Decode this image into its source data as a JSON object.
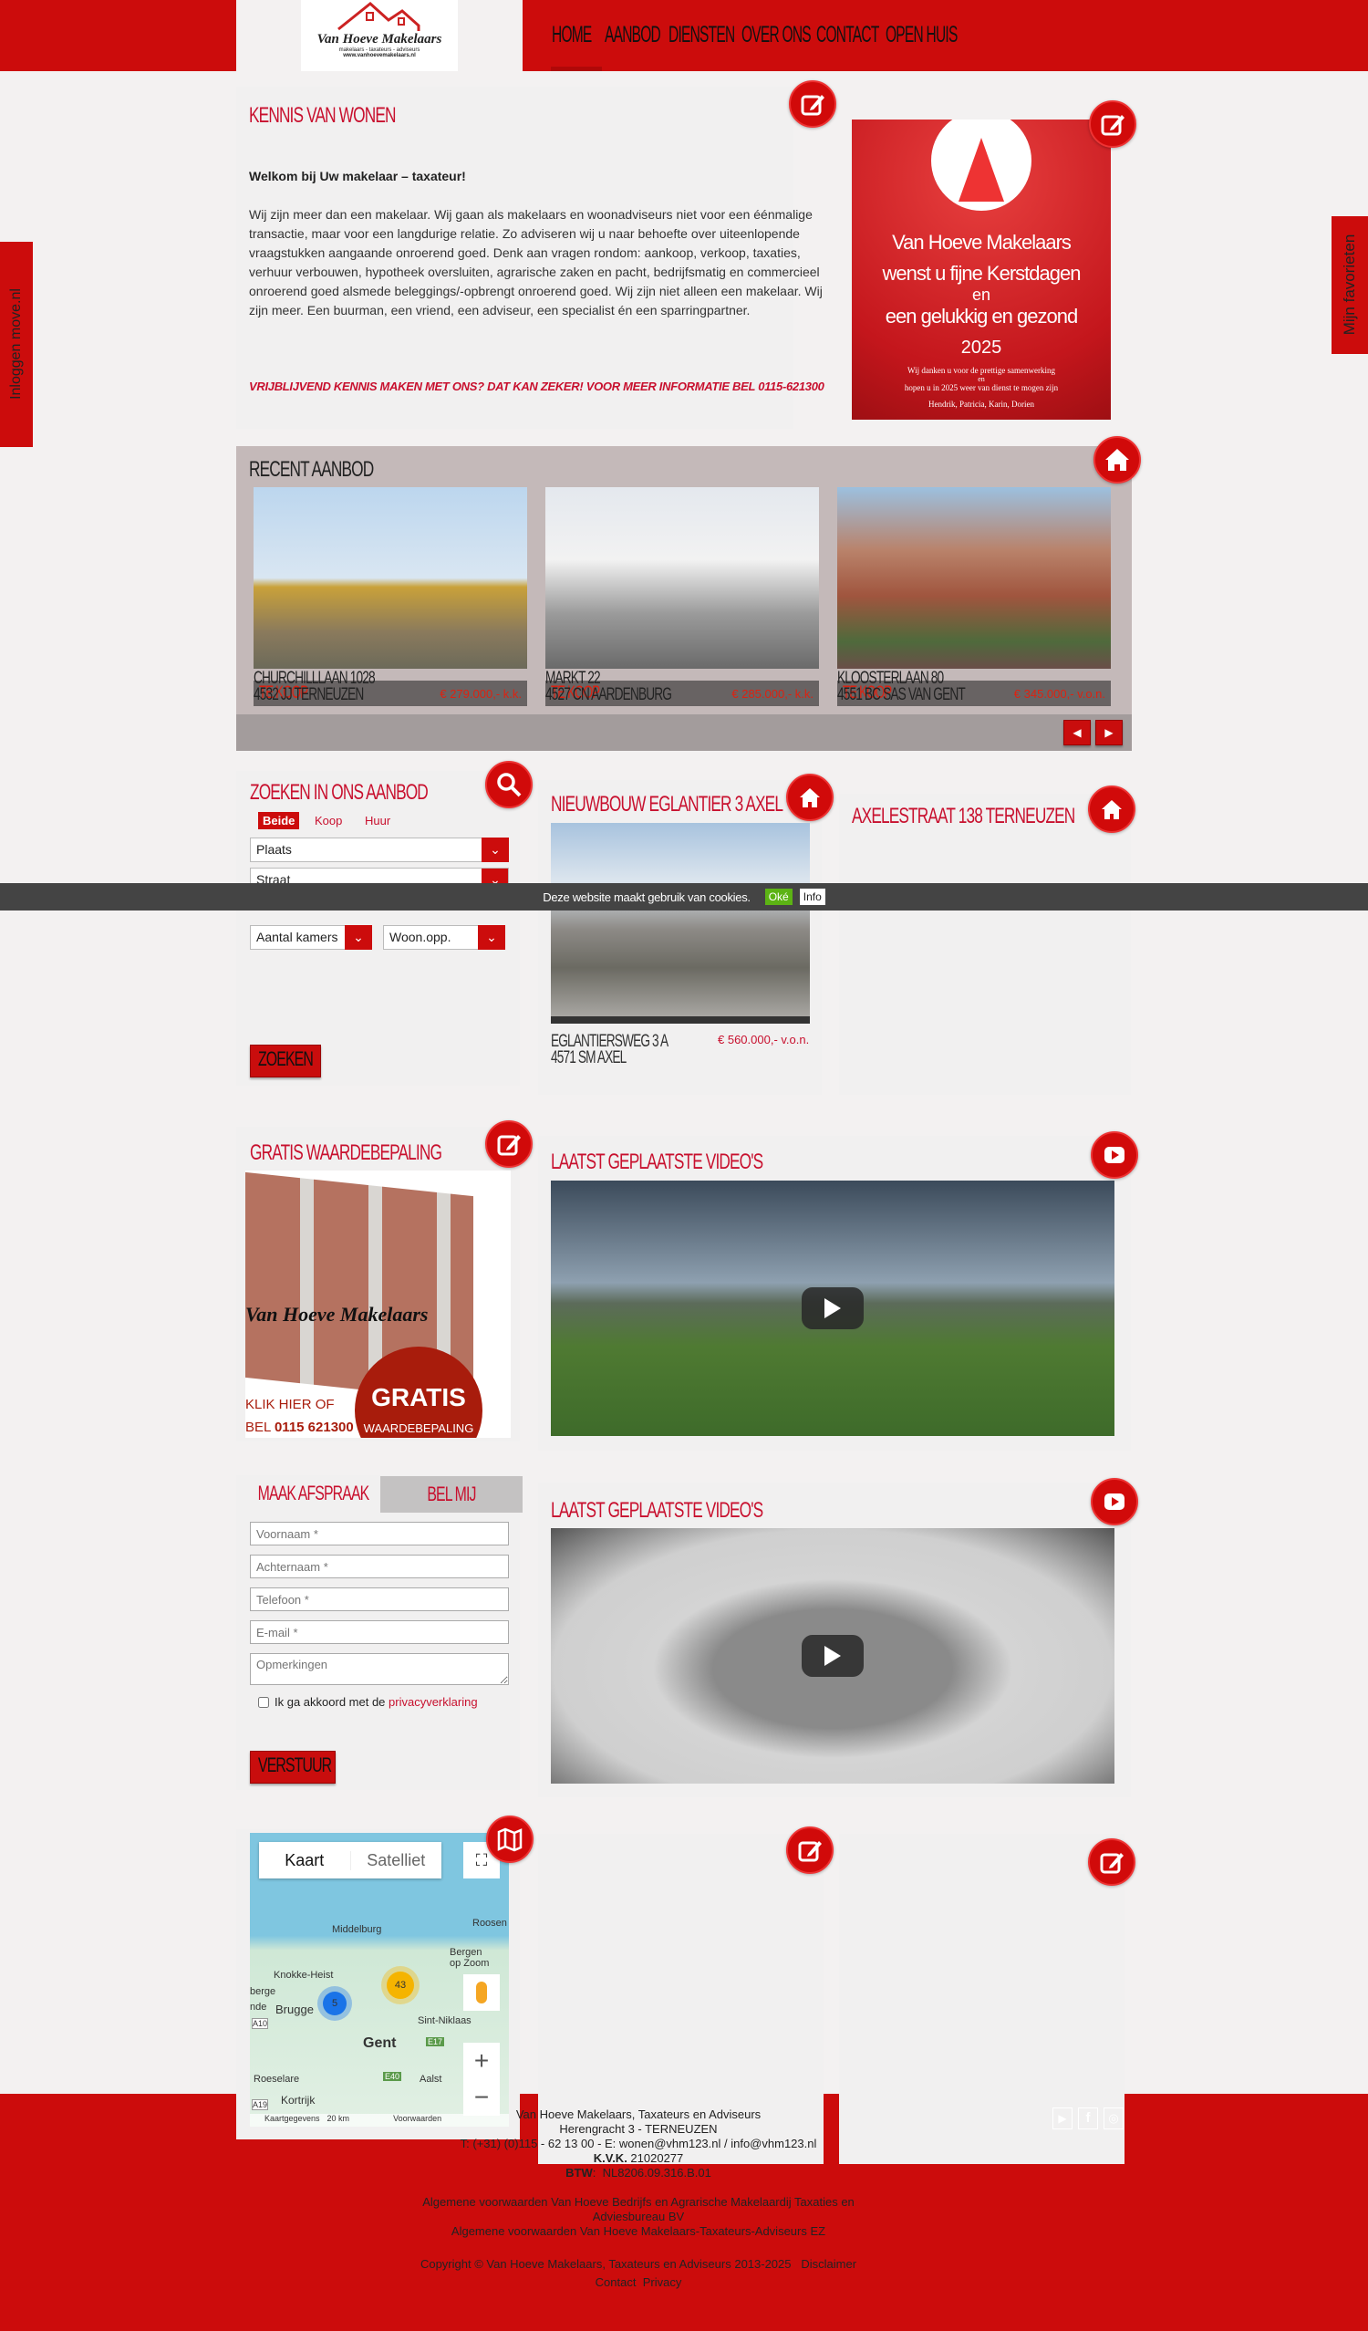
{
  "colors": {
    "brand_red": "#cc0c0c",
    "background": "#f3f1f1",
    "recent_bg": "#c4b9b9"
  },
  "header": {
    "logo_text": "Van Hoeve Makelaars",
    "logo_tagline": "makelaars - taxateurs - adviseurs",
    "logo_url": "www.vanhoevemakelaars.nl",
    "nav": [
      "HOME",
      "AANBOD",
      "DIENSTEN",
      "OVER ONS",
      "CONTACT",
      "OPEN HUIS"
    ]
  },
  "side_tabs": {
    "left": "Inloggen move.nl",
    "right": "Mijn favorieten"
  },
  "kennis": {
    "title": "KENNIS VAN WONEN",
    "intro": "Welkom bij Uw makelaar – taxateur!",
    "body": "Wij zijn meer dan een makelaar. Wij gaan als makelaars en woonadviseurs niet voor een éénmalige transactie, maar voor een langdurige relatie. Zo adviseren wij u naar behoefte over uiteenlopende vraagstukken aangaande onroerend goed. Denk aan vragen rondom: aankoop, verkoop, taxaties, verhuur verbouwen, hypotheek oversluiten, agrarische zaken en pacht, bedrijfsmatig en commercieel onroerend goed alsmede beleggings/-opbrengt onroerend goed. Wij zijn niet alleen een makelaar. Wij zijn meer. Een buurman, een vriend, een adviseur, een specialist én een sparringpartner.",
    "cta": "VRIJBLIJVEND KENNIS MAKEN MET ONS? DAT KAN ZEKER! VOOR MEER INFORMATIE BEL 0115-621300",
    "icon": "edit-icon"
  },
  "xmas": {
    "line1": "Van Hoeve Makelaars",
    "line2": "wenst u fijne Kerstdagen",
    "line3": "en",
    "line4": "een gelukkig en gezond",
    "line5": "2025",
    "small1": "Wij danken u voor de prettige samenwerking",
    "small2": "en",
    "small3": "hopen u in 2025 weer van dienst te mogen zijn",
    "names": "Hendrik, Patricia, Karin, Dorien"
  },
  "recent": {
    "title": "RECENT AANBOD",
    "items": [
      {
        "status": "TE KOOP",
        "price": "€ 279.000,- k.k.",
        "street": "CHURCHILLLAAN 1028",
        "city": "4532 JJ TERNEUZEN"
      },
      {
        "status": "TE KOOP",
        "price": "€ 285.000,- k.k.",
        "street": "MARKT 22",
        "city": "4527 CN AARDENBURG"
      },
      {
        "status": "TE KOOP",
        "price": "€ 345.000,- v.o.n.",
        "street": "KLOOSTERLAAN 80",
        "city": "4551 BC SAS VAN GENT"
      }
    ]
  },
  "search": {
    "title": "ZOEKEN IN ONS AANBOD",
    "tabs": [
      "Beide",
      "Koop",
      "Huur"
    ],
    "place": "Plaats",
    "street": "Straat",
    "rooms": "Aantal kamers",
    "area": "Woon.opp.",
    "button": "ZOEKEN"
  },
  "nieuwbouw": {
    "title": "NIEUWBOUW EGLANTIER 3 AXEL",
    "street": "EGLANTIERSWEG 3 A",
    "city": "4571 SM AXEL",
    "price": "€ 560.000,- v.o.n."
  },
  "axelestraat": {
    "title": "AXELESTRAAT 138 TERNEUZEN"
  },
  "cookie": {
    "text": "Deze website maakt gebruik van cookies.",
    "ok": "Oké",
    "info": "Info"
  },
  "gratis": {
    "title": "GRATIS WAARDEBEPALING",
    "sign": "Van Hoeve Makelaars",
    "badge1": "GRATIS",
    "badge2": "WAARDEBEPALING",
    "klik": "KLIK HIER OF",
    "bel": "BEL",
    "phone": "0115 621300"
  },
  "videos": {
    "title": "LAATST GEPLAATSTE VIDEO'S"
  },
  "form": {
    "tab_active": "MAAK AFSPRAAK",
    "tab_other": "BEL MIJ",
    "first": "Voornaam *",
    "last": "Achternaam *",
    "phone": "Telefoon *",
    "email": "E-mail *",
    "remarks": "Opmerkingen",
    "agree": "Ik ga akkoord met de ",
    "privacy": "privacyverklaring",
    "submit": "VERSTUUR"
  },
  "map": {
    "kaart": "Kaart",
    "satelliet": "Satelliet",
    "cluster1": "43",
    "cluster2": "5",
    "places": [
      "Middelburg",
      "Roosen",
      "Bergen op Zoom",
      "Knokke-Heist",
      "berge",
      "Brugge",
      "Sint-Niklaas",
      "Gent",
      "Roeselare",
      "Aalst",
      "Kortrijk",
      "A10",
      "E17",
      "E40",
      "A19",
      "nde"
    ],
    "attribution": "Kaartgegevens",
    "scale": "20 km",
    "terms": "Voorwaarden"
  },
  "footer": {
    "company": "Van Hoeve Makelaars, Taxateurs en Adviseurs",
    "address": "Herengracht 3 - TERNEUZEN",
    "contact": "T: (+31) (0)115 - 62 13 00 - E: wonen@vhm123.nl / info@vhm123.nl",
    "kvk_label": "K.V.K.",
    "kvk": " 21020277",
    "btw_label": "BTW",
    "btw": ":  NL8206.09.316.B.01",
    "terms1": "Algemene voorwaarden Van Hoeve Bedrijfs en Agrarische Makelaardij Taxaties en Adviesbureau BV",
    "terms2": "Algemene voorwaarden Van Hoeve Makelaars-Taxateurs-Adviseurs EZ",
    "copyright": "Copyright © Van Hoeve Makelaars, Taxateurs en Adviseurs 2013-2025",
    "disclaimer": "Disclaimer",
    "contact_link": "Contact",
    "privacy": "Privacy"
  }
}
